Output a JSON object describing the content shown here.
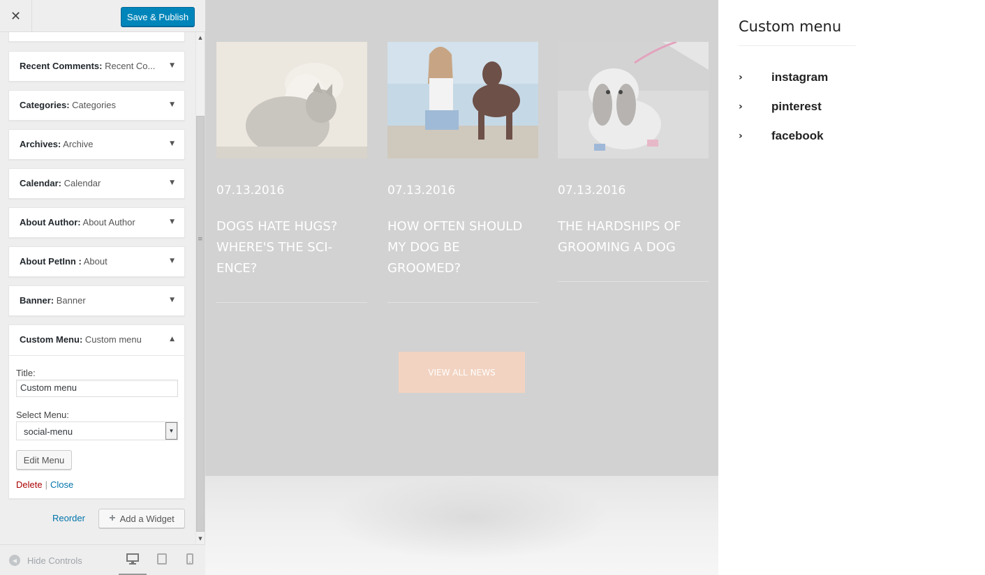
{
  "topbar": {
    "close_icon": "close-icon",
    "publish_label": "Save & Publish"
  },
  "widgets": [
    {
      "type": "Recent Comments",
      "name": "Recent Co...",
      "icon": "arrow-down-icon"
    },
    {
      "type": "Categories",
      "name": "Categories",
      "icon": "arrow-down-icon"
    },
    {
      "type": "Archives",
      "name": "Archive",
      "icon": "arrow-down-icon"
    },
    {
      "type": "Calendar",
      "name": "Calendar",
      "icon": "arrow-down-icon"
    },
    {
      "type": "About Author",
      "name": "About Author",
      "icon": "arrow-down-icon"
    },
    {
      "type": "About PetInn ",
      "name": "About",
      "icon": "arrow-down-icon"
    },
    {
      "type": "Banner",
      "name": "Banner",
      "icon": "arrow-down-icon"
    }
  ],
  "open_widget": {
    "type": "Custom Menu",
    "name": "Custom menu",
    "title_label": "Title:",
    "title_value": "Custom menu",
    "select_label": "Select Menu:",
    "select_value": "social-menu",
    "edit_label": "Edit Menu",
    "delete_label": "Delete",
    "separator": "|",
    "close_label": "Close"
  },
  "actions": {
    "reorder_label": "Reorder",
    "add_widget_label": "Add a Widget"
  },
  "footer": {
    "hide_controls_label": "Hide Controls",
    "devices": [
      "desktop-icon",
      "tablet-icon",
      "mobile-icon"
    ]
  },
  "preview": {
    "posts": [
      {
        "date": "07.13.2016",
        "title_lines": [
          "DOGS HATE HUGS?",
          "WHERE'S THE SCI-",
          "ENCE?"
        ],
        "image": "cat-and-puppy-image"
      },
      {
        "date": "07.13.2016",
        "title_lines": [
          "HOW OFTEN SHOULD",
          "MY DOG BE",
          "GROOMED?"
        ],
        "image": "woman-with-dog-image"
      },
      {
        "date": "07.13.2016",
        "title_lines": [
          "THE HARDSHIPS OF",
          "GROOMING A DOG"
        ],
        "image": "shih-tzu-image"
      }
    ],
    "view_all_label": "VIEW ALL NEWS"
  },
  "custom_menu": {
    "heading": "Custom menu",
    "items": [
      {
        "label": "instagram",
        "icon": "chevron-right-icon"
      },
      {
        "label": "pinterest",
        "icon": "chevron-right-icon"
      },
      {
        "label": "facebook",
        "icon": "chevron-right-icon"
      }
    ]
  },
  "colors": {
    "primary_button": "#0085ba",
    "preview_overlay": "#d2d2d2",
    "view_all_button": "#f2d3c1",
    "delete_link": "#aa0000",
    "link": "#0073aa"
  }
}
